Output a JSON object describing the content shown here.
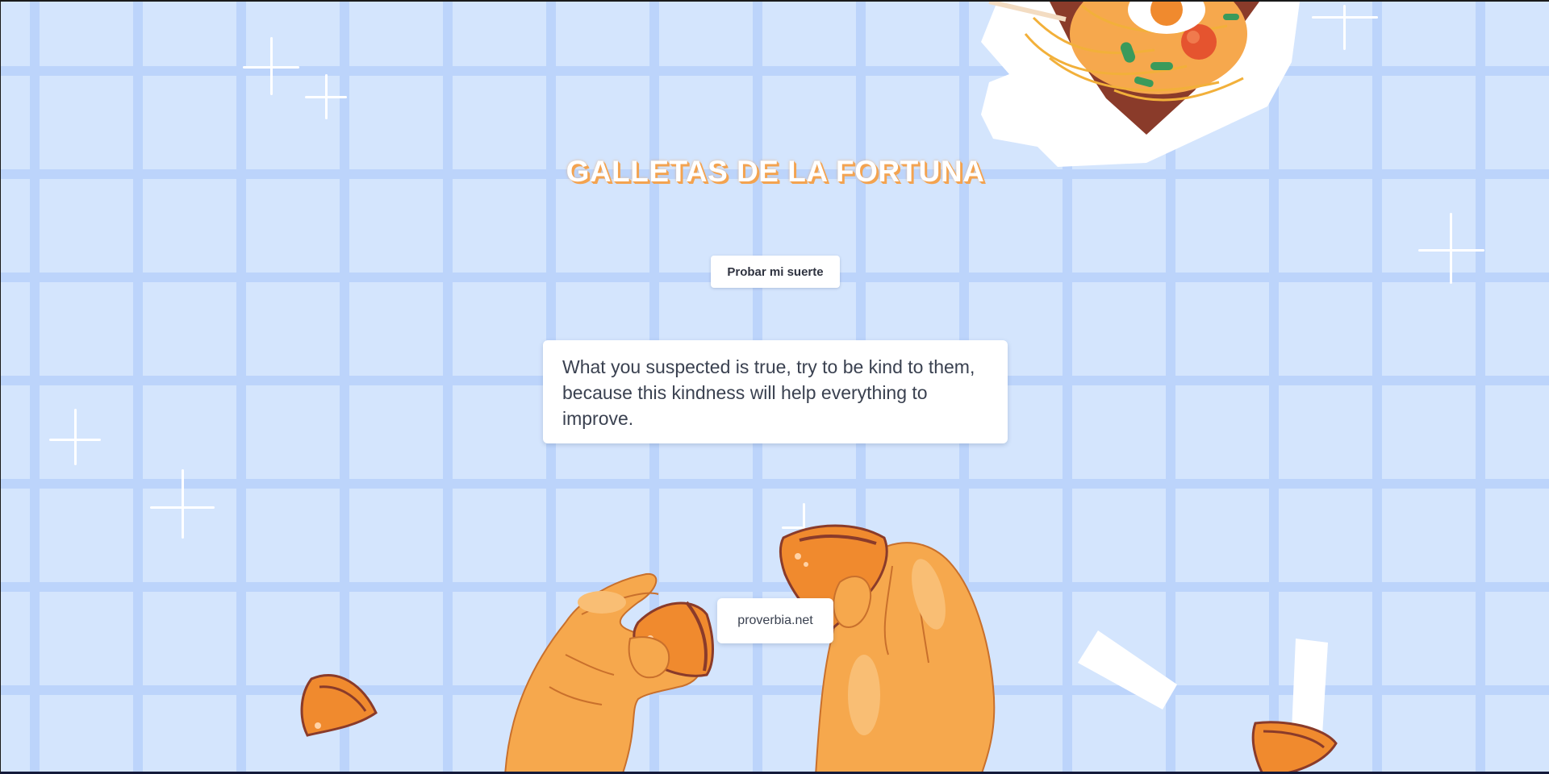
{
  "header": {
    "title": "GALLETAS DE LA FORTUNA"
  },
  "actions": {
    "luck_button_label": "Probar mi suerte"
  },
  "fortune": {
    "quote": "What you suspected is true, try to be kind to them, because this kindness will help everything to improve.",
    "source": "proverbia.net"
  },
  "theme": {
    "background": "#d4e5fd",
    "grid_line": "#bcd4fb",
    "title_shadow": "#f3a350",
    "cookie": "#f08a2e",
    "hand": "#f6a84d"
  },
  "decorations": {
    "icons": [
      "sparkle-icon",
      "noodle-box-icon",
      "fortune-cookie-icon",
      "hands-holding-cookie-icon",
      "paper-fortune-slip-icon"
    ]
  }
}
